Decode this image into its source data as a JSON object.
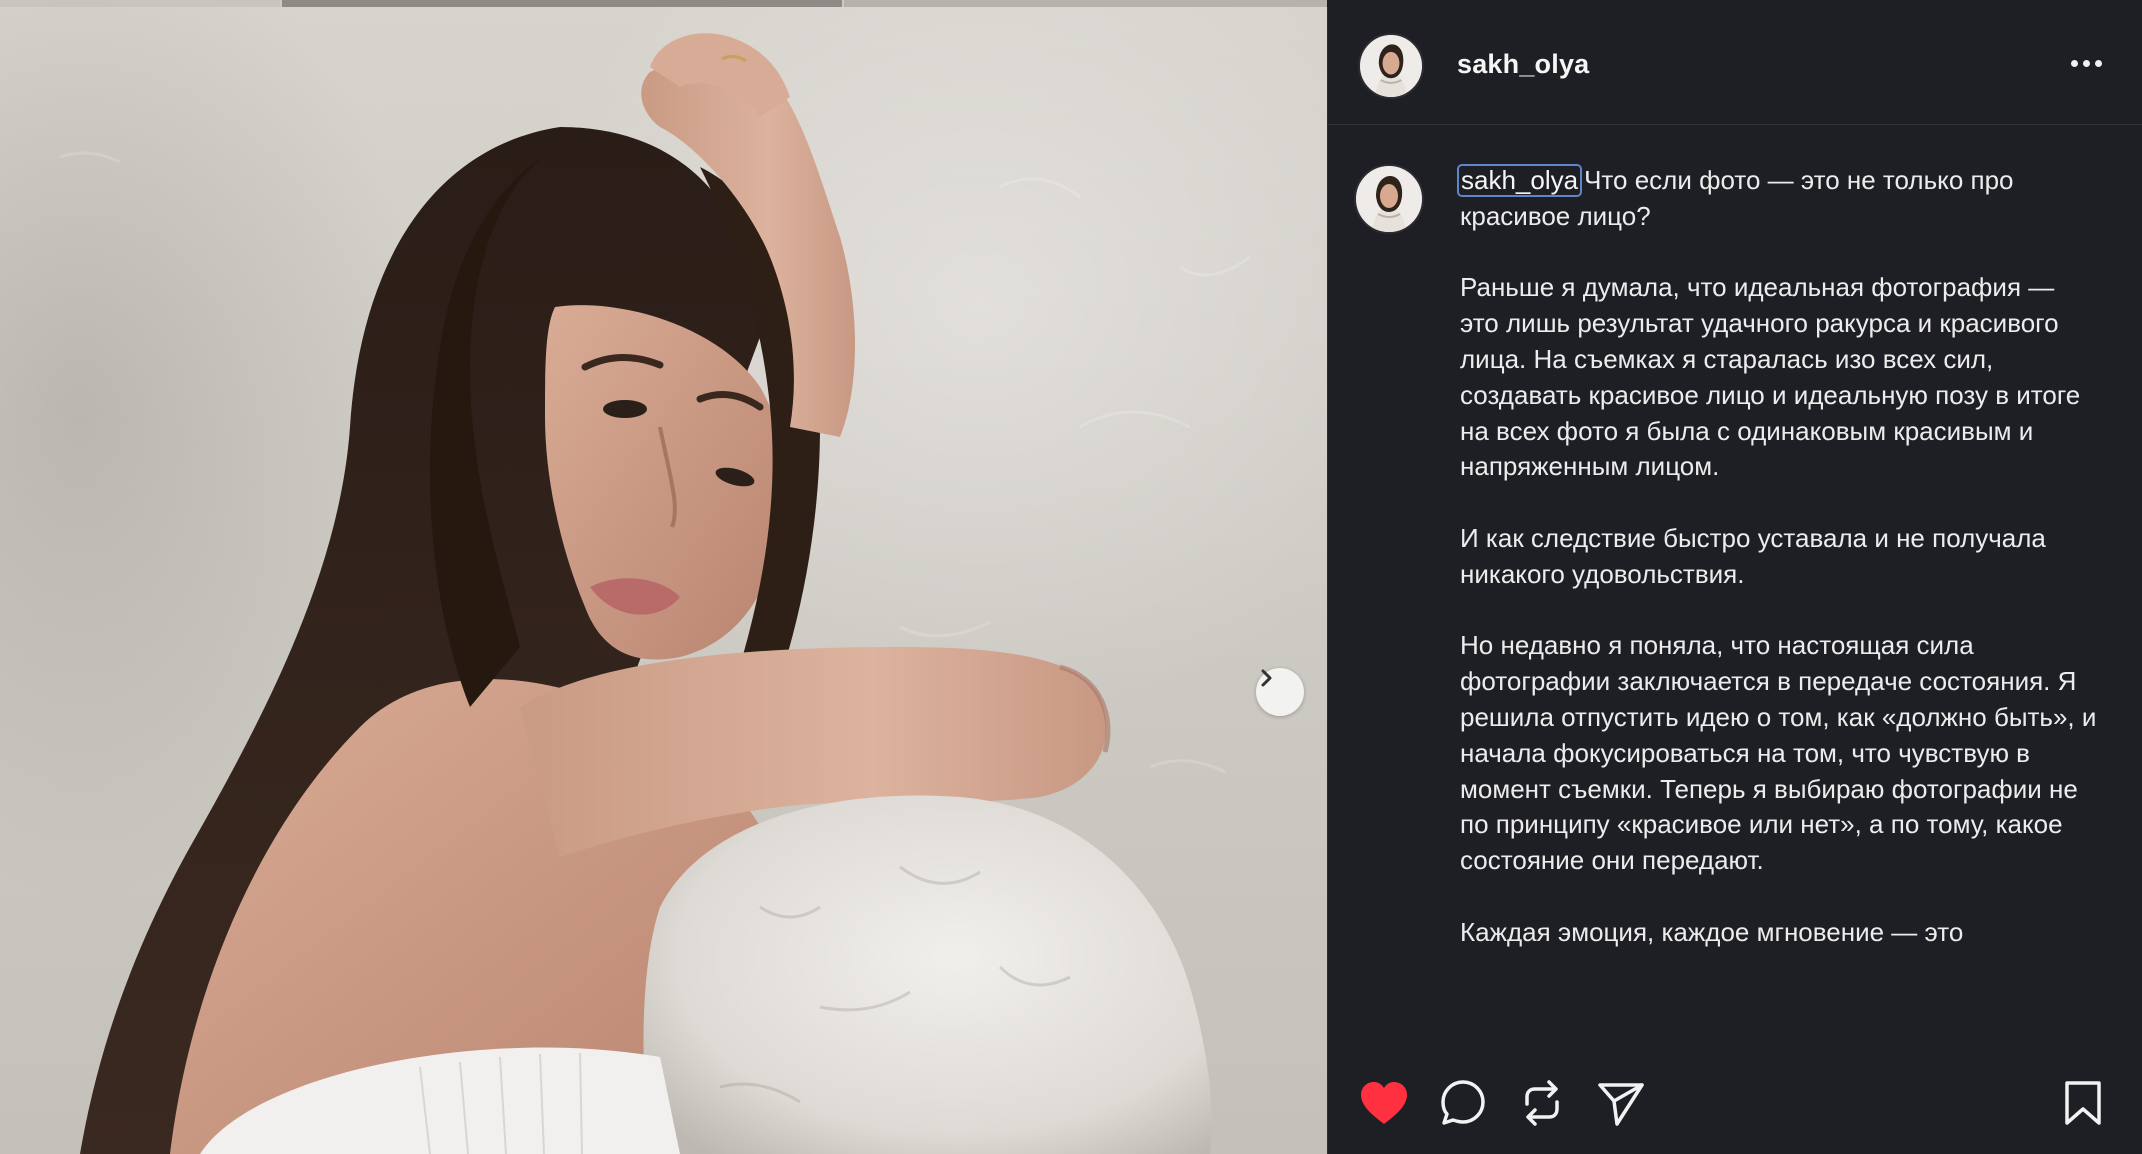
{
  "post": {
    "username": "sakh_olya",
    "caption_user": "sakh_olya",
    "caption_text": "Что если фото — это не только про красивое лицо?\n\nРаньше я думала, что идеальная фотография — это лишь результат удачного ракурса и красивого лица. На съемках я старалась изо всех сил, создавать красивое лицо и идеальную позу в итоге на всех фото я была с одинаковым красивым и напряженным лицом.\n\nИ как следствие быстро уставала и не получала никакого удовольствия.\n\nНо недавно я поняла, что настоящая сила фотографии заключается в передаче состояния. Я решила отпустить идею о том, как «должно быть», и начала фокусироваться на том, что чувствую в момент съемки. Теперь я выбираю фотографии не по принципу «красивое или нет», а по тому, какое состояние они передают.\n\nКаждая эмоция, каждое мгновение — это"
  },
  "icons": {
    "more": "more-dots-icon",
    "next": "chevron-right-icon",
    "like": "heart-filled-icon",
    "comment": "comment-bubble-icon",
    "repost": "repost-arrows-icon",
    "share": "send-paper-plane-icon",
    "save": "bookmark-icon"
  },
  "colors": {
    "panel_bg": "#1e1f24",
    "like": "#ff3040",
    "text": "#ececec",
    "mention_outline": "#5b86c7"
  }
}
